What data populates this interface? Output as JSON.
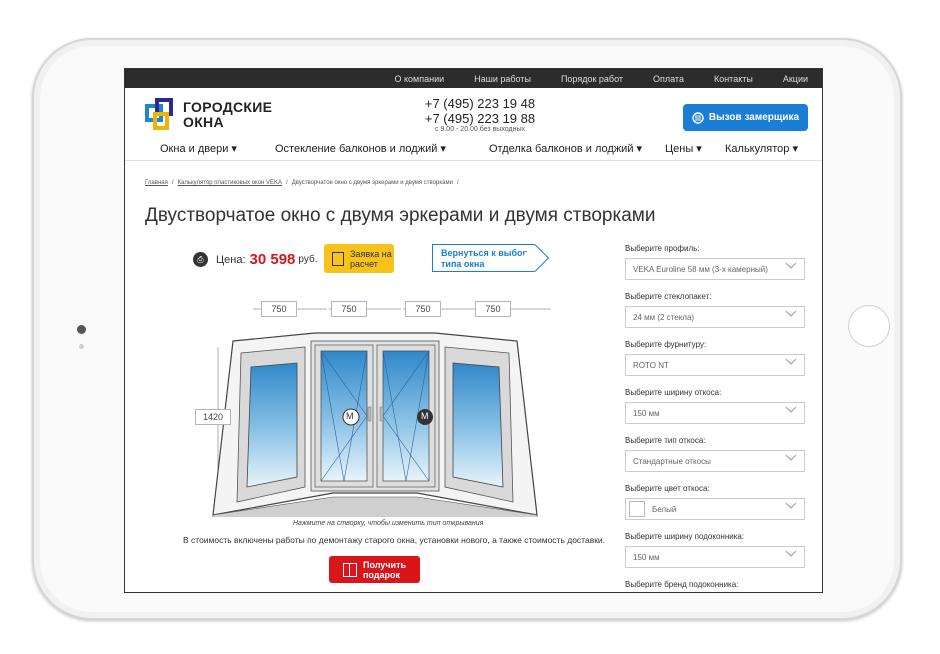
{
  "top_nav": [
    "О компании",
    "Наши работы",
    "Порядок работ",
    "Оплата",
    "Контакты",
    "Акции"
  ],
  "logo": {
    "line1": "ГОРОДСКИЕ",
    "line2": "ОКНА"
  },
  "phones": {
    "phone1": "+7 (495) 223 19 48",
    "phone2": "+7 (495) 223 19 88",
    "hours": "с 9.00 - 20.00 без выходных"
  },
  "call_button": "Вызов замерщика",
  "main_menu": [
    "Окна и двери ▾",
    "Остекление балконов и лоджий ▾",
    "Отделка балконов и лоджий ▾",
    "Цены ▾",
    "Калькулятор ▾"
  ],
  "breadcrumb": {
    "home": "Главная",
    "calc": "Калькулятор пластиковых окон VEKA",
    "current": "Двустворчатое окно с двумя эркерами и двумя створками",
    "sep": "/"
  },
  "page_title": "Двустворчатое окно с двумя эркерами и двумя створками",
  "price": {
    "label": "Цена:",
    "value": "30 598",
    "currency": "руб."
  },
  "order_button": {
    "line1": "Заявка на",
    "line2": "расчет"
  },
  "back_button": {
    "line1": "Вернуться к выбору",
    "line2": "типа окна"
  },
  "window": {
    "widths": [
      "750",
      "750",
      "750",
      "750"
    ],
    "height": "1420",
    "sash_marker": "M"
  },
  "hint": "Нажмите на створку, чтобы изменить тип открывания",
  "note": "В стоимость включены работы по демонтажу старого окна, установки нового, а также стоимость доставки.",
  "gift_button": {
    "line1": "Получить",
    "line2": "подарок"
  },
  "options": {
    "profile": {
      "label": "Выберите профиль:",
      "value": "VEKA Euroline 58 мм (3-х камерный)"
    },
    "glass": {
      "label": "Выберите стеклопакет:",
      "value": "24 мм (2 стекла)"
    },
    "hardware": {
      "label": "Выберите фурнитуру:",
      "value": "ROTO NT"
    },
    "slope_width": {
      "label": "Выберите ширину откоса:",
      "value": "150 мм"
    },
    "slope_type": {
      "label": "Выберите тип откоса:",
      "value": "Стандартные откосы"
    },
    "slope_color": {
      "label": "Выберите цвет откоса:",
      "value": "Белый"
    },
    "sill_width": {
      "label": "Выберите ширину подоконника:",
      "value": "150 мм"
    },
    "sill_brand": {
      "label": "Выберите бренд подоконника:"
    }
  },
  "colors": {
    "brand_blue": "#1a7fd4",
    "price_red": "#d9141b",
    "order_yellow": "#f7c21a",
    "topnav_bg": "#2c2c2c"
  }
}
